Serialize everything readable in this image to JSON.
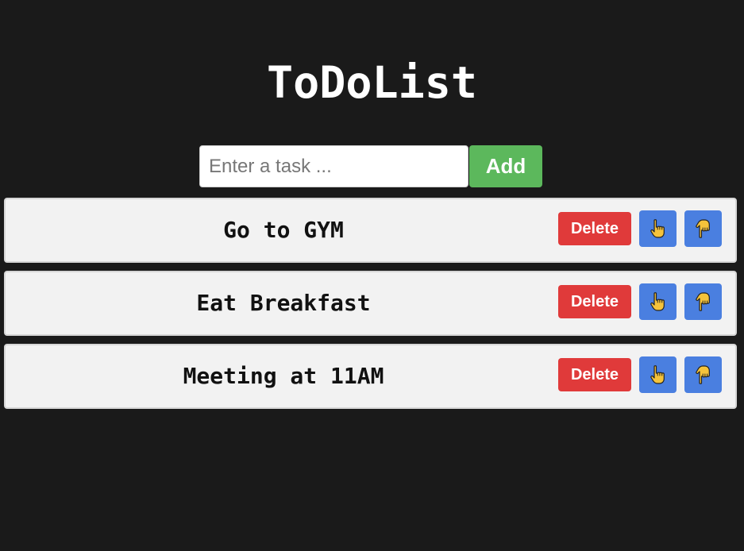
{
  "app": {
    "title": "ToDoList"
  },
  "input": {
    "placeholder": "Enter a task ...",
    "value": ""
  },
  "add_button": {
    "label": "Add"
  },
  "tasks": [
    {
      "text": "Go to GYM",
      "delete_label": "Delete",
      "up_icon": "hand-pointing-up-icon",
      "down_icon": "hand-pointing-down-icon"
    },
    {
      "text": "Eat Breakfast",
      "delete_label": "Delete",
      "up_icon": "hand-pointing-up-icon",
      "down_icon": "hand-pointing-down-icon"
    },
    {
      "text": "Meeting at 11AM",
      "delete_label": "Delete",
      "up_icon": "hand-pointing-up-icon",
      "down_icon": "hand-pointing-down-icon"
    }
  ],
  "colors": {
    "background": "#1a1a1a",
    "add_button": "#5cb85c",
    "delete_button": "#e03a3a",
    "move_button": "#4a7fe0",
    "task_background": "#f2f2f2",
    "hand_icon": "#f5c33b"
  }
}
